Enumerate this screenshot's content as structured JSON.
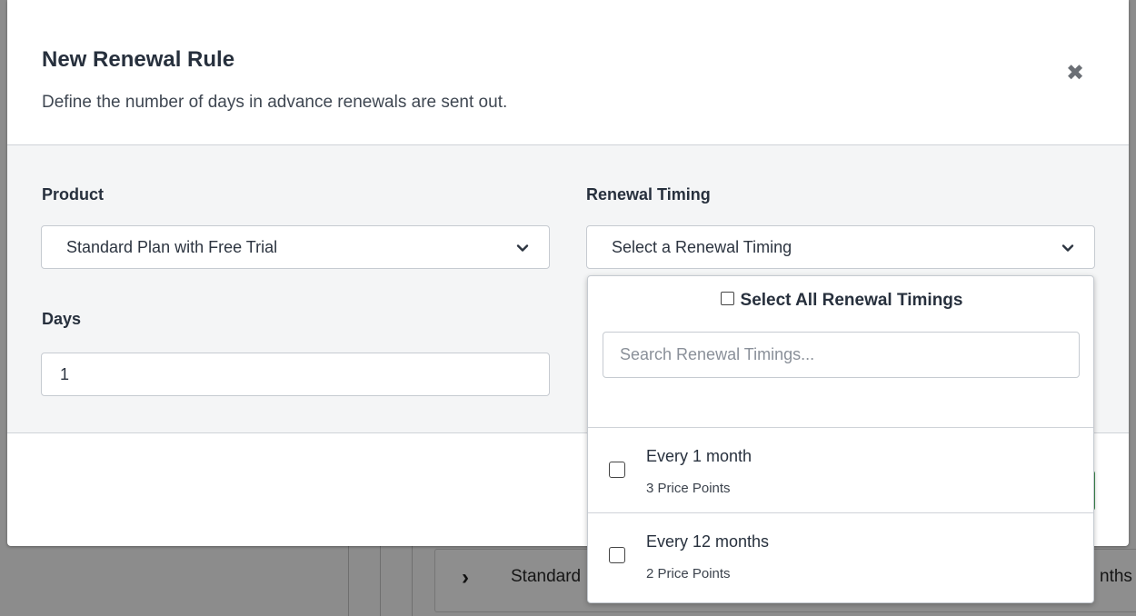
{
  "background": {
    "row_name": "Standard",
    "row_end": "nths"
  },
  "modal": {
    "title": "New Renewal Rule",
    "subtitle": "Define the number of days in advance renewals are sent out.",
    "close_icon": "close-icon"
  },
  "form": {
    "product_label": "Product",
    "product_value": "Standard Plan with Free Trial",
    "renewal_timing_label": "Renewal Timing",
    "renewal_timing_value": "Select a Renewal Timing",
    "days_label": "Days",
    "days_value": "1"
  },
  "dropdown": {
    "select_all_label": "Select All Renewal Timings",
    "search_placeholder": "Search Renewal Timings...",
    "options": [
      {
        "label": "Every 1 month",
        "sub": "3 Price Points"
      },
      {
        "label": "Every 12 months",
        "sub": "2 Price Points"
      }
    ]
  },
  "colors": {
    "overlay": "#8c8c8c",
    "accent_green": "#3a8a4c"
  }
}
